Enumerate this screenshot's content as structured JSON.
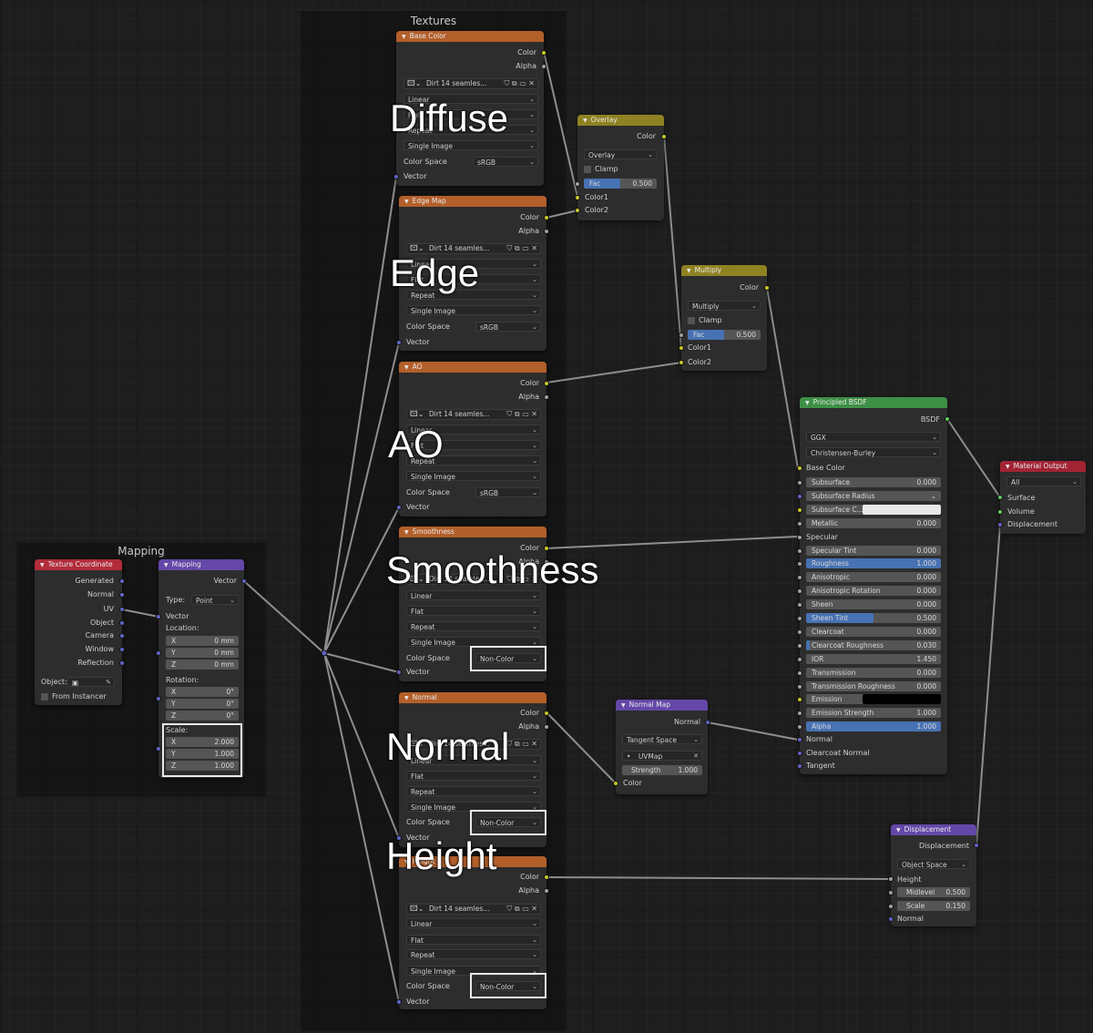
{
  "frames": {
    "textures": "Textures",
    "mapping": "Mapping"
  },
  "annotations": {
    "diffuse": "Diffuse",
    "edge": "Edge",
    "ao": "AO",
    "smoothness": "Smoothness",
    "normal": "Normal",
    "height": "Height"
  },
  "texture_coordinate": {
    "title": "Texture Coordinate",
    "outputs": [
      "Generated",
      "Normal",
      "UV",
      "Object",
      "Camera",
      "Window",
      "Reflection"
    ],
    "object_label": "Object:",
    "from_instancer": "From Instancer"
  },
  "mapping": {
    "title": "Mapping",
    "output": "Vector",
    "type_label": "Type:",
    "type_value": "Point",
    "vector_label": "Vector",
    "location_label": "Location:",
    "location": [
      {
        "axis": "X",
        "value": "0 mm"
      },
      {
        "axis": "Y",
        "value": "0 mm"
      },
      {
        "axis": "Z",
        "value": "0 mm"
      }
    ],
    "rotation_label": "Rotation:",
    "rotation": [
      {
        "axis": "X",
        "value": "0°"
      },
      {
        "axis": "Y",
        "value": "0°"
      },
      {
        "axis": "Z",
        "value": "0°"
      }
    ],
    "scale_label": "Scale:",
    "scale": [
      {
        "axis": "X",
        "value": "2.000"
      },
      {
        "axis": "Y",
        "value": "1.000"
      },
      {
        "axis": "Z",
        "value": "1.000"
      }
    ]
  },
  "base_color": {
    "title": "Base Color",
    "color": "Color",
    "alpha": "Alpha",
    "image": "Dirt 14 seamles...",
    "interp": "Linear",
    "proj": "Flat",
    "ext": "Repeat",
    "source": "Single Image",
    "cs_label": "Color Space",
    "cs_value": "sRGB",
    "vector": "Vector"
  },
  "edge_map": {
    "title": "Edge Map",
    "color": "Color",
    "alpha": "Alpha",
    "image": "Dirt 14 seamles...",
    "interp": "Linear",
    "proj": "Flat",
    "ext": "Repeat",
    "source": "Single Image",
    "cs_label": "Color Space",
    "cs_value": "sRGB",
    "vector": "Vector"
  },
  "ao": {
    "title": "AO",
    "color": "Color",
    "alpha": "Alpha",
    "image": "Dirt 14 seamles...",
    "interp": "Linear",
    "proj": "Flat",
    "ext": "Repeat",
    "source": "Single Image",
    "cs_label": "Color Space",
    "cs_value": "sRGB",
    "vector": "Vector"
  },
  "smoothness": {
    "title": "Smoothness",
    "color": "Color",
    "alpha": "Alpha",
    "image": "Dirt 14 seamles...",
    "interp": "Linear",
    "proj": "Flat",
    "ext": "Repeat",
    "source": "Single Image",
    "cs_label": "Color Space",
    "cs_value": "Non-Color",
    "vector": "Vector"
  },
  "normal_tex": {
    "title": "Normal",
    "color": "Color",
    "alpha": "Alpha",
    "image": "Dirt 14 seamles...",
    "interp": "Linear",
    "proj": "Flat",
    "ext": "Repeat",
    "source": "Single Image",
    "cs_label": "Color Space",
    "cs_value": "Non-Color",
    "vector": "Vector"
  },
  "height_tex": {
    "title": "Height",
    "color": "Color",
    "alpha": "Alpha",
    "image": "Dirt 14 seamles...",
    "interp": "Linear",
    "proj": "Flat",
    "ext": "Repeat",
    "source": "Single Image",
    "cs_label": "Color Space",
    "cs_value": "Non-Color",
    "vector": "Vector"
  },
  "overlay": {
    "title": "Overlay",
    "output": "Color",
    "mode": "Overlay",
    "clamp": "Clamp",
    "fac_label": "Fac",
    "fac": "0.500",
    "fac_level": 0.5,
    "color1": "Color1",
    "color2": "Color2"
  },
  "multiply": {
    "title": "Multiply",
    "output": "Color",
    "mode": "Multiply",
    "clamp": "Clamp",
    "fac_label": "Fac",
    "fac": "0.500",
    "fac_level": 0.5,
    "color1": "Color1",
    "color2": "Color2"
  },
  "principled": {
    "title": "Principled BSDF",
    "output": "BSDF",
    "distribution": "GGX",
    "subsurface_method": "Christensen-Burley",
    "base_color": "Base Color",
    "rows": [
      {
        "label": "Subsurface",
        "value": "0.000",
        "level": 0
      },
      {
        "label": "Subsurface Radius",
        "value": "",
        "level": 0,
        "type": "dropdown"
      },
      {
        "label": "Subsurface C...",
        "value": "",
        "level": 0,
        "type": "color",
        "color": "#e8e8e8"
      },
      {
        "label": "Metallic",
        "value": "0.000",
        "level": 0
      },
      {
        "label": "Specular",
        "value": "",
        "level": 0,
        "type": "socket"
      },
      {
        "label": "Specular Tint",
        "value": "0.000",
        "level": 0
      },
      {
        "label": "Roughness",
        "value": "1.000",
        "level": 1
      },
      {
        "label": "Anisotropic",
        "value": "0.000",
        "level": 0
      },
      {
        "label": "Anisotropic Rotation",
        "value": "0.000",
        "level": 0
      },
      {
        "label": "Sheen",
        "value": "0.000",
        "level": 0
      },
      {
        "label": "Sheen Tint",
        "value": "0.500",
        "level": 0.5
      },
      {
        "label": "Clearcoat",
        "value": "0.000",
        "level": 0
      },
      {
        "label": "Clearcoat Roughness",
        "value": "0.030",
        "level": 0.03
      },
      {
        "label": "IOR",
        "value": "1.450",
        "level": 0
      },
      {
        "label": "Transmission",
        "value": "0.000",
        "level": 0
      },
      {
        "label": "Transmission Roughness",
        "value": "0.000",
        "level": 0
      },
      {
        "label": "Emission",
        "value": "",
        "level": 0,
        "type": "color",
        "color": "#000000"
      },
      {
        "label": "Emission Strength",
        "value": "1.000",
        "level": 0
      },
      {
        "label": "Alpha",
        "value": "1.000",
        "level": 1
      }
    ],
    "normal": "Normal",
    "clearcoat_normal": "Clearcoat Normal",
    "tangent": "Tangent"
  },
  "material_output": {
    "title": "Material Output",
    "target": "All",
    "surface": "Surface",
    "volume": "Volume",
    "displacement": "Displacement"
  },
  "normal_map": {
    "title": "Normal Map",
    "output": "Normal",
    "space": "Tangent Space",
    "uv": "UVMap",
    "strength_label": "Strength",
    "strength": "1.000",
    "color": "Color"
  },
  "displacement": {
    "title": "Displacement",
    "output": "Displacement",
    "space": "Object Space",
    "height": "Height",
    "midlevel_label": "Midlevel",
    "midlevel": "0.500",
    "scale_label": "Scale",
    "scale": "0.150",
    "normal": "Normal"
  },
  "colors": {
    "texture_header": "#b35f2a",
    "color_header": "#8f8222",
    "vector_header": "#6447a8",
    "input_header": "#b22c3b",
    "shader_header": "#3e9046",
    "output_header": "#a22434",
    "fill": "#4772b3",
    "socket_color": "#c7c729",
    "socket_vector": "#6363c7",
    "socket_float": "#a1a1a1",
    "socket_shader": "#63c763"
  }
}
